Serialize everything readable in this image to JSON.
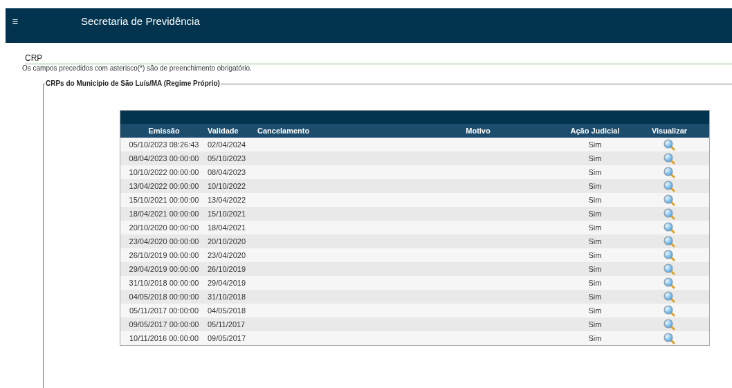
{
  "header": {
    "menu_glyph": "≡",
    "title": "Secretaria de Previdência"
  },
  "page": {
    "title": "CRP",
    "note": "Os campos precedidos com asterisco(*) são de preenchimento obrigatório."
  },
  "fieldset": {
    "legend": "CRPs do Município de São Luís/MA (Regime Próprio)"
  },
  "table": {
    "columns": [
      "Emissão",
      "Validade",
      "Cancelamento",
      "Motivo",
      "Ação Judicial",
      "Visualizar"
    ],
    "rows": [
      {
        "emissao": "05/10/2023 08:26:43",
        "validade": "02/04/2024",
        "acao_judicial": "Sim"
      },
      {
        "emissao": "08/04/2023 00:00:00",
        "validade": "05/10/2023",
        "acao_judicial": "Sim"
      },
      {
        "emissao": "10/10/2022 00:00:00",
        "validade": "08/04/2023",
        "acao_judicial": "Sim"
      },
      {
        "emissao": "13/04/2022 00:00:00",
        "validade": "10/10/2022",
        "acao_judicial": "Sim"
      },
      {
        "emissao": "15/10/2021 00:00:00",
        "validade": "13/04/2022",
        "acao_judicial": "Sim"
      },
      {
        "emissao": "18/04/2021 00:00:00",
        "validade": "15/10/2021",
        "acao_judicial": "Sim"
      },
      {
        "emissao": "20/10/2020 00:00:00",
        "validade": "18/04/2021",
        "acao_judicial": "Sim"
      },
      {
        "emissao": "23/04/2020 00:00:00",
        "validade": "20/10/2020",
        "acao_judicial": "Sim"
      },
      {
        "emissao": "26/10/2019 00:00:00",
        "validade": "23/04/2020",
        "acao_judicial": "Sim"
      },
      {
        "emissao": "29/04/2019 00:00:00",
        "validade": "26/10/2019",
        "acao_judicial": "Sim"
      },
      {
        "emissao": "31/10/2018 00:00:00",
        "validade": "29/04/2019",
        "acao_judicial": "Sim"
      },
      {
        "emissao": "04/05/2018 00:00:00",
        "validade": "31/10/2018",
        "acao_judicial": "Sim"
      },
      {
        "emissao": "05/11/2017 00:00:00",
        "validade": "04/05/2018",
        "acao_judicial": "Sim"
      },
      {
        "emissao": "09/05/2017 00:00:00",
        "validade": "05/11/2017",
        "acao_judicial": "Sim"
      },
      {
        "emissao": "10/11/2016 00:00:00",
        "validade": "09/05/2017",
        "acao_judicial": "Sim"
      }
    ]
  }
}
